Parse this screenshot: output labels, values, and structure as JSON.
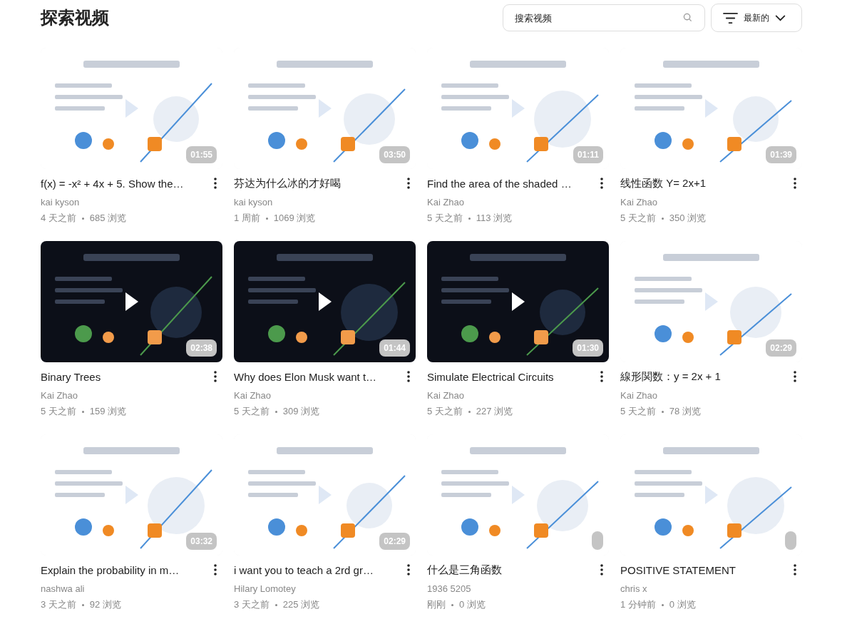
{
  "page_title": "探索视频",
  "search": {
    "placeholder": "搜索视频"
  },
  "sort": {
    "label": "最新的"
  },
  "videos": [
    {
      "title": "f(x) = -x² + 4x + 5. Show the…",
      "author": "kai kyson",
      "time": "4 天之前",
      "views": "685 浏览",
      "duration": "01:55",
      "thumbnail": {
        "kind": "picture",
        "dark": false
      }
    },
    {
      "title": "芬达为什么冰的才好喝",
      "author": "kai kyson",
      "time": "1 周前",
      "views": "1069 浏览",
      "duration": "03:50",
      "thumbnail": {
        "kind": "picture",
        "dark": false
      }
    },
    {
      "title": "Find the area of the shaded …",
      "author": "Kai Zhao",
      "time": "5 天之前",
      "views": "113 浏览",
      "duration": "01:11",
      "thumbnail": {
        "kind": "picture",
        "dark": false
      }
    },
    {
      "title": "线性函数 Y= 2x+1",
      "author": "Kai Zhao",
      "time": "5 天之前",
      "views": "350 浏览",
      "duration": "01:39",
      "thumbnail": {
        "kind": "picture",
        "dark": false
      }
    },
    {
      "title": "Binary Trees",
      "author": "Kai Zhao",
      "time": "5 天之前",
      "views": "159 浏览",
      "duration": "02:38",
      "thumbnail": {
        "kind": "picture",
        "dark": true
      }
    },
    {
      "title": "Why does Elon Musk want t…",
      "author": "Kai Zhao",
      "time": "5 天之前",
      "views": "309 浏览",
      "duration": "01:44",
      "thumbnail": {
        "kind": "picture",
        "dark": true
      }
    },
    {
      "title": "Simulate Electrical Circuits",
      "author": "Kai Zhao",
      "time": "5 天之前",
      "views": "227 浏览",
      "duration": "01:30",
      "thumbnail": {
        "kind": "picture",
        "dark": true
      }
    },
    {
      "title": "線形関数：y = 2x + 1",
      "author": "Kai Zhao",
      "time": "5 天之前",
      "views": "78 浏览",
      "duration": "02:29",
      "thumbnail": {
        "kind": "picture",
        "dark": false
      }
    },
    {
      "title": "Explain the probability in m…",
      "author": "nashwa ali",
      "time": "3 天之前",
      "views": "92 浏览",
      "duration": "03:32",
      "thumbnail": {
        "kind": "picture",
        "dark": false
      }
    },
    {
      "title": "i want you to teach a 2rd gr…",
      "author": "Hilary Lomotey",
      "time": "3 天之前",
      "views": "225 浏览",
      "duration": "02:29",
      "thumbnail": {
        "kind": "picture",
        "dark": false
      }
    },
    {
      "title": "什么是三角函数",
      "author": "1936 5205",
      "time": "刚刚",
      "views": "0 浏览",
      "processing": true,
      "thumbnail": {
        "kind": "picture",
        "dark": false
      }
    },
    {
      "title": "POSITIVE STATEMENT",
      "author": "chris x",
      "time": "1 分钟前",
      "views": "0 浏览",
      "processing": true,
      "thumbnail": {
        "kind": "picture",
        "dark": false
      }
    }
  ]
}
